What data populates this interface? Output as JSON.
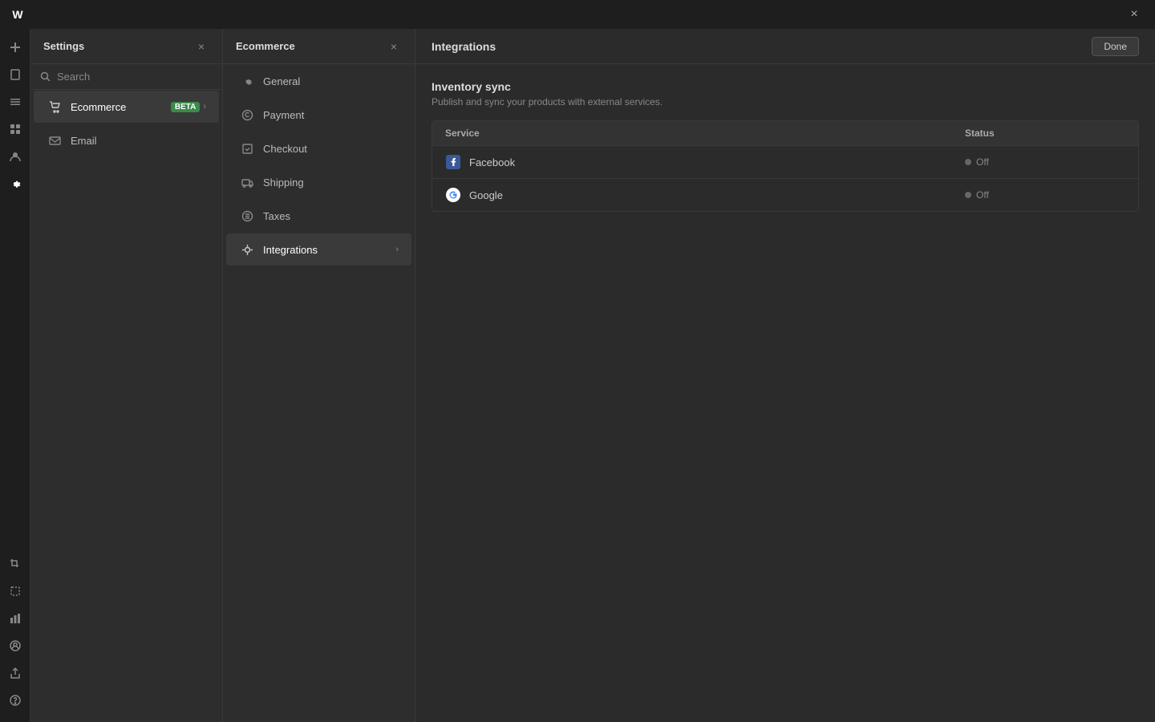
{
  "titlebar": {
    "logo": "W",
    "close_icon": "×"
  },
  "icon_sidebar": {
    "top_items": [
      {
        "name": "add-icon",
        "glyph": "+"
      },
      {
        "name": "pages-icon",
        "glyph": "⬜"
      },
      {
        "name": "layers-icon",
        "glyph": "≡"
      },
      {
        "name": "components-icon",
        "glyph": "⊞"
      },
      {
        "name": "contacts-icon",
        "glyph": "👤"
      },
      {
        "name": "settings-icon",
        "glyph": "⚙"
      }
    ],
    "bottom_items": [
      {
        "name": "crop-icon",
        "glyph": "⊡"
      },
      {
        "name": "select-icon",
        "glyph": "⬚"
      },
      {
        "name": "equalizer-icon",
        "glyph": "⊟"
      },
      {
        "name": "user-icon",
        "glyph": "◎"
      },
      {
        "name": "share-icon",
        "glyph": "⇧"
      },
      {
        "name": "help-icon",
        "glyph": "?"
      }
    ]
  },
  "settings_panel": {
    "title": "Settings",
    "close_label": "×",
    "search_placeholder": "Search",
    "nav_items": [
      {
        "id": "ecommerce",
        "label": "Ecommerce",
        "badge": "BETA",
        "has_chevron": true,
        "active": true
      },
      {
        "id": "email",
        "label": "Email",
        "has_chevron": false,
        "active": false
      }
    ]
  },
  "ecommerce_panel": {
    "title": "Ecommerce",
    "close_label": "×",
    "nav_items": [
      {
        "id": "general",
        "label": "General",
        "active": false
      },
      {
        "id": "payment",
        "label": "Payment",
        "active": false
      },
      {
        "id": "checkout",
        "label": "Checkout",
        "active": false
      },
      {
        "id": "shipping",
        "label": "Shipping",
        "active": false
      },
      {
        "id": "taxes",
        "label": "Taxes",
        "active": false
      },
      {
        "id": "integrations",
        "label": "Integrations",
        "active": true,
        "has_chevron": true
      }
    ]
  },
  "integrations_panel": {
    "title": "Integrations",
    "done_label": "Done",
    "section_title": "Inventory sync",
    "section_subtitle": "Publish and sync your products with external services.",
    "table": {
      "headers": [
        "Service",
        "Status"
      ],
      "rows": [
        {
          "service": "Facebook",
          "status": "Off",
          "icon_name": "facebook-icon"
        },
        {
          "service": "Google",
          "status": "Off",
          "icon_name": "google-icon"
        }
      ]
    }
  }
}
